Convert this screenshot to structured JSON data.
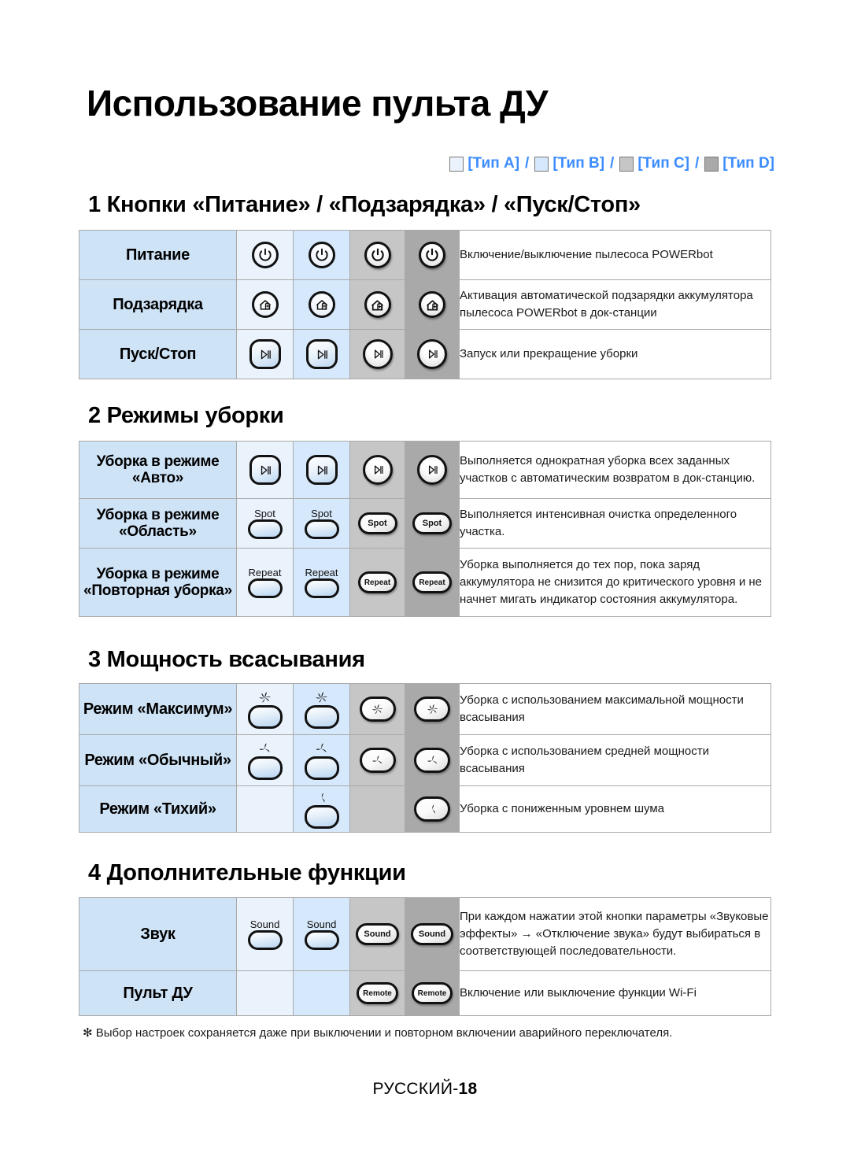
{
  "page": {
    "title": "Использование пульта ДУ",
    "footnote": "✻ Выбор настроек сохраняется даже при выключении и повторном включении аварийного переключателя.",
    "footer_label": "РУССКИЙ",
    "footer_sep": "-",
    "footer_page": "18"
  },
  "legend": {
    "separator": "/",
    "items": [
      {
        "label": "[Тип A]",
        "color": "#eaf3fc"
      },
      {
        "label": "[Тип B]",
        "color": "#d6e8fb"
      },
      {
        "label": "[Тип C]",
        "color": "#c6c6c6"
      },
      {
        "label": "[Тип D]",
        "color": "#a9a9a9"
      }
    ],
    "text_color": "#3b8cff"
  },
  "sections": [
    {
      "heading": "1 Кнопки «Питание» / «Подзарядка» / «Пуск/Стоп»",
      "rows": [
        {
          "label": "Питание",
          "icon": "power-icon",
          "desc": "Включение/выключение пылесоса POWERbot"
        },
        {
          "label": "Подзарядка",
          "icon": "dock-charge-icon",
          "desc": "Активация автоматической подзарядки аккумулятора пылесоса POWERbot в док-станции"
        },
        {
          "label": "Пуск/Стоп",
          "icon": "play-pause-icon",
          "desc": "Запуск или прекращение уборки"
        }
      ]
    },
    {
      "heading": "2 Режимы уборки",
      "rows": [
        {
          "label": "Уборка в режиме «Авто»",
          "icon": "play-pause-icon",
          "desc": "Выполняется однократная уборка всех заданных участков с автоматическим возвратом в док-станцию."
        },
        {
          "label": "Уборка в режиме «Область»",
          "icon": "spot-button",
          "caption": "Spot",
          "desc": "Выполняется интенсивная очистка определенного участка."
        },
        {
          "label": "Уборка в режиме «Повторная уборка»",
          "icon": "repeat-button",
          "caption": "Repeat",
          "desc": "Уборка выполняется до тех пор, пока заряд аккумулятора не снизится до критического уровня и не начнет мигать индикатор состояния аккумулятора."
        }
      ]
    },
    {
      "heading": "3 Мощность всасывания",
      "rows": [
        {
          "label": "Режим «Максимум»",
          "icon": "fan-max-icon",
          "desc": "Уборка с использованием максимальной мощности всасывания"
        },
        {
          "label": "Режим «Обычный»",
          "icon": "fan-normal-icon",
          "desc": "Уборка с использованием средней мощности всасывания"
        },
        {
          "label": "Режим «Тихий»",
          "icon": "fan-quiet-icon",
          "desc": "Уборка с пониженным уровнем шума"
        }
      ]
    },
    {
      "heading": "4 Дополнительные функции",
      "rows": [
        {
          "label": "Звук",
          "icon": "sound-button",
          "caption": "Sound",
          "desc": "При каждом нажатии этой кнопки параметры «Звуковые эффекты» → «Отключение звука» будут выбираться в соответствующей последовательности."
        },
        {
          "label": "Пульт ДУ",
          "icon": "remote-button",
          "caption": "Remote",
          "desc": "Включение или выключение функции Wi-Fi"
        }
      ]
    }
  ]
}
